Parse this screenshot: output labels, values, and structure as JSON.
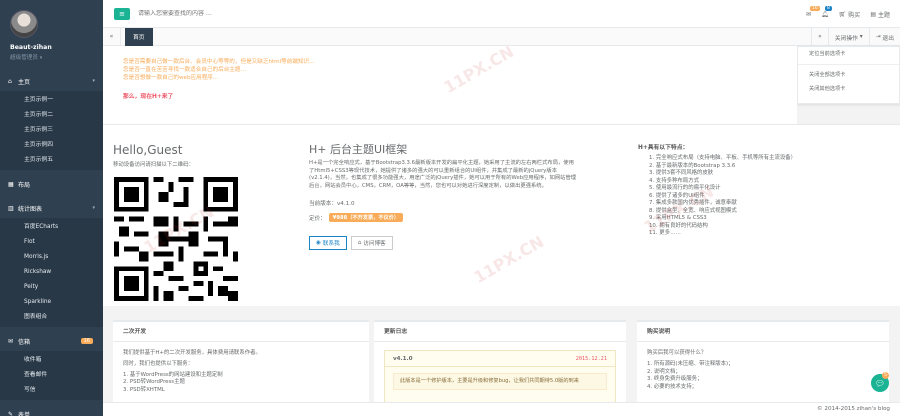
{
  "sidebar": {
    "user_name": "Beaut-zihan",
    "user_role": "超级管理员",
    "groups": [
      {
        "icon": "⌂",
        "label": "主页",
        "items": [
          "主页示例一",
          "主页示例二",
          "主页示例三",
          "主页示例四",
          "主页示例五"
        ]
      },
      {
        "icon": "▦",
        "label": "布局",
        "items": []
      },
      {
        "icon": "▥",
        "label": "统计图表",
        "items": [
          "百度ECharts",
          "Flot",
          "Morris.js",
          "Rickshaw",
          "Peity",
          "Sparkline",
          "图表组合"
        ]
      },
      {
        "icon": "✉",
        "label": "信箱",
        "badge": "16",
        "items": [
          "收件箱",
          "查看邮件",
          "写信"
        ]
      },
      {
        "icon": "✎",
        "label": "表单",
        "items": []
      }
    ]
  },
  "topbar": {
    "search_placeholder": "请输入您需要查找的内容 …",
    "mail_badge": "16",
    "alert_badge": "8",
    "buy_label": "购买",
    "theme_label": "主题"
  },
  "tabs": {
    "active": "首页",
    "close_ops": "关闭操作",
    "logout": "退出"
  },
  "dropdown": {
    "items": [
      "定位当前选项卡",
      "关闭全部选项卡",
      "关闭其他选项卡"
    ]
  },
  "notice": {
    "lines": [
      "您是否需要自己做一款后台、会员中心等等的，但是又缺乏html等前端知识…",
      "您是否一直在苦苦寻找一款适合自己的后台主题…",
      "您是否想做一款自己的web应用程序…"
    ],
    "strong": "那么，现在H+来了"
  },
  "hello": {
    "title": "Hello,Guest",
    "subtitle": "移动设备访问请扫描以下二维码："
  },
  "hplus": {
    "title": "H+ 后台主题UI框架",
    "desc": "H+是一个完全响应式，基于Bootstrap3.3.6最新版本开发的扁平化主题，她采用了主流的左右两栏式布局，使用了Html5+CSS3等现代技术，她提供了诸多的强大的可以重新组合的UI组件，并集成了最新的jQuery版本(v2.1.4)，当然，也集成了很多功能强大，用途广泛的jQuery插件，她可以用于所有的Web应用程序，如网站管理后台，网站会员中心，CMS，CRM，OA等等，当然，您也可以对她进行深度定制，以做出更强系统。",
    "version": "当前版本：v4.1.0",
    "price_label": "定价：",
    "price": "¥988（不开发票，不议价）",
    "contact_btn": "联系我",
    "visit_btn": "访问博客"
  },
  "features": {
    "title": "H+具有以下特点：",
    "items": [
      "1. 完全响应式布局（支持电脑、平板、手机等所有主流设备）",
      "2. 基于最新版本的Bootstrap 3.3.6",
      "3. 提供3套不同风格的皮肤",
      "4. 支持多种布局方式",
      "5. 使用最流行的的扁平化设计",
      "6. 提供了诸多的UI组件",
      "7. 集成多款国内优秀插件，诚意奉献",
      "8. 提供盒型、全宽、响应式视图模式",
      "9. 采用HTML5 & CSS3",
      "10. 拥有良好的代码结构",
      "11. 更多……"
    ]
  },
  "panels": {
    "dev": {
      "title": "二次开发",
      "lines": [
        "我们提供基于H+的二次开发服务，具体费用请联系作者。",
        "同时，我们也提供以下服务：",
        "1. 基于WordPress的网站建设和主题定制",
        "2. PSD转WordPress主题",
        "3. PSD转XHTML"
      ]
    },
    "log": {
      "title": "更新日志",
      "version": "v4.1.0",
      "date": "2015.12.21",
      "note": "此版本是一个修护版本，主要是升级和修复bug，让我们共同期待5.0版的到来"
    },
    "buy": {
      "title": "购买说明",
      "lines": [
        "购买后我可以获得什么？",
        "1. 所有源码(未压缩、带注释版本)；",
        "2. 说明文档；",
        "3. 终身免费升级服务；",
        "4. 必要的技术支持；"
      ]
    }
  },
  "chat_badge": "5",
  "footer": "© 2014-2015 zihan's blog",
  "watermark": "11PX.CN"
}
